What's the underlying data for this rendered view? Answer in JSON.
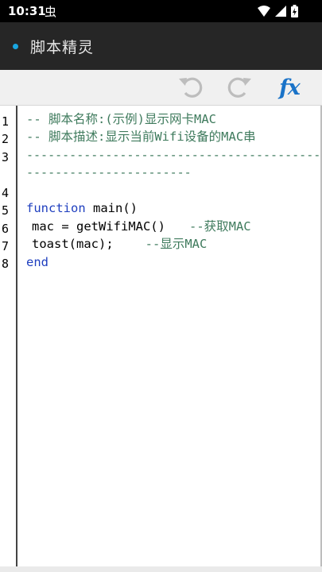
{
  "status": {
    "time": "10:31",
    "notif_glyph": "虫"
  },
  "app": {
    "title": "脚本精灵",
    "accent": "#19a6e0"
  },
  "toolbar": {
    "fx_label": "fx"
  },
  "editor": {
    "line_numbers": [
      "1",
      "2",
      "3",
      "4",
      "5",
      "6",
      "7",
      "8"
    ],
    "l1": "-- 脚本名称:(示例)显示网卡MAC",
    "l2": "-- 脚本描述:显示当前Wifi设备的MAC串",
    "l3a": "-----------------------------------------",
    "l3b": "-----------------------",
    "l5_kw": "function",
    "l5_rest": " main()",
    "l6_code": "mac = getWifiMAC()",
    "l6_comment": "--获取MAC",
    "l7_code": "toast(mac);",
    "l7_comment": "--显示MAC",
    "l8_kw": "end"
  }
}
